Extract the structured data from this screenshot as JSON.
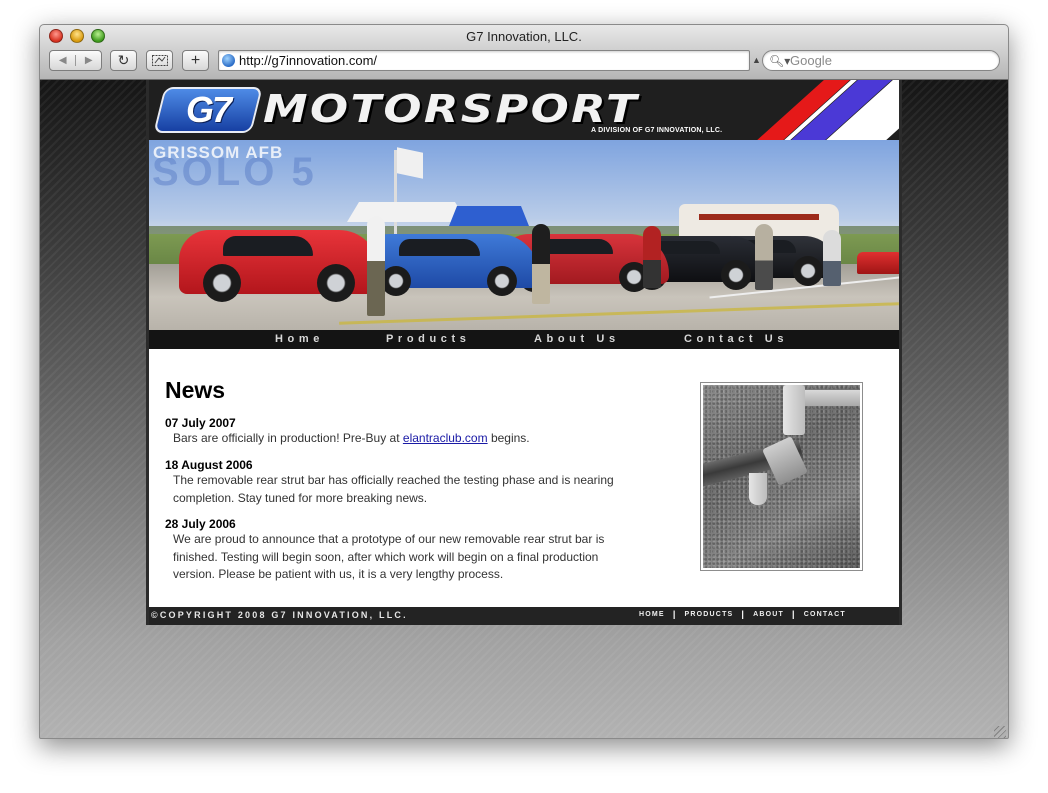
{
  "browser": {
    "window_title": "G7 Innovation, LLC.",
    "url": "http://g7innovation.com/",
    "search_placeholder": "Google",
    "reload_glyph": "↻",
    "add_glyph": "+",
    "back_glyph": "◀",
    "forward_glyph": "▶"
  },
  "header": {
    "logo_text": "G7",
    "wordmark": "MOTORSPORT",
    "division": "A DIVISION OF G7 INNOVATION, LLC.",
    "stripe_colors": [
      "#e51919",
      "#4b39d6",
      "#ffffff"
    ]
  },
  "hero": {
    "event_line1": "GRISSOM AFB",
    "event_line2": "SOLO 5"
  },
  "nav": {
    "home": "Home",
    "products": "Products",
    "about": "About Us",
    "contact": "Contact Us"
  },
  "news": {
    "heading": "News",
    "entries": [
      {
        "date": "07 July 2007",
        "text_before_link": "Bars are officially in production! Pre-Buy at ",
        "link_text": "elantraclub.com",
        "text_after_link": " begins."
      },
      {
        "date": "18 August 2006",
        "text": "The removable rear strut bar has officially reached the testing phase and is nearing completion. Stay tuned for more breaking news."
      },
      {
        "date": "28 July 2006",
        "text": "We are proud to announce that a prototype of our new removable rear strut bar is finished. Testing will begin soon, after which work will begin on a final production version. Please be patient with us, it is a very lengthy process."
      }
    ]
  },
  "footer": {
    "copyright": "©COPYRIGHT 2008 G7 INNOVATION, LLC.",
    "links": [
      "HOME",
      "PRODUCTS",
      "ABOUT",
      "CONTACT"
    ],
    "separator": "|"
  },
  "colors": {
    "accent_blue": "#1f4fb8",
    "page_dark": "#1f1f1f",
    "link": "#1a1aa6"
  }
}
